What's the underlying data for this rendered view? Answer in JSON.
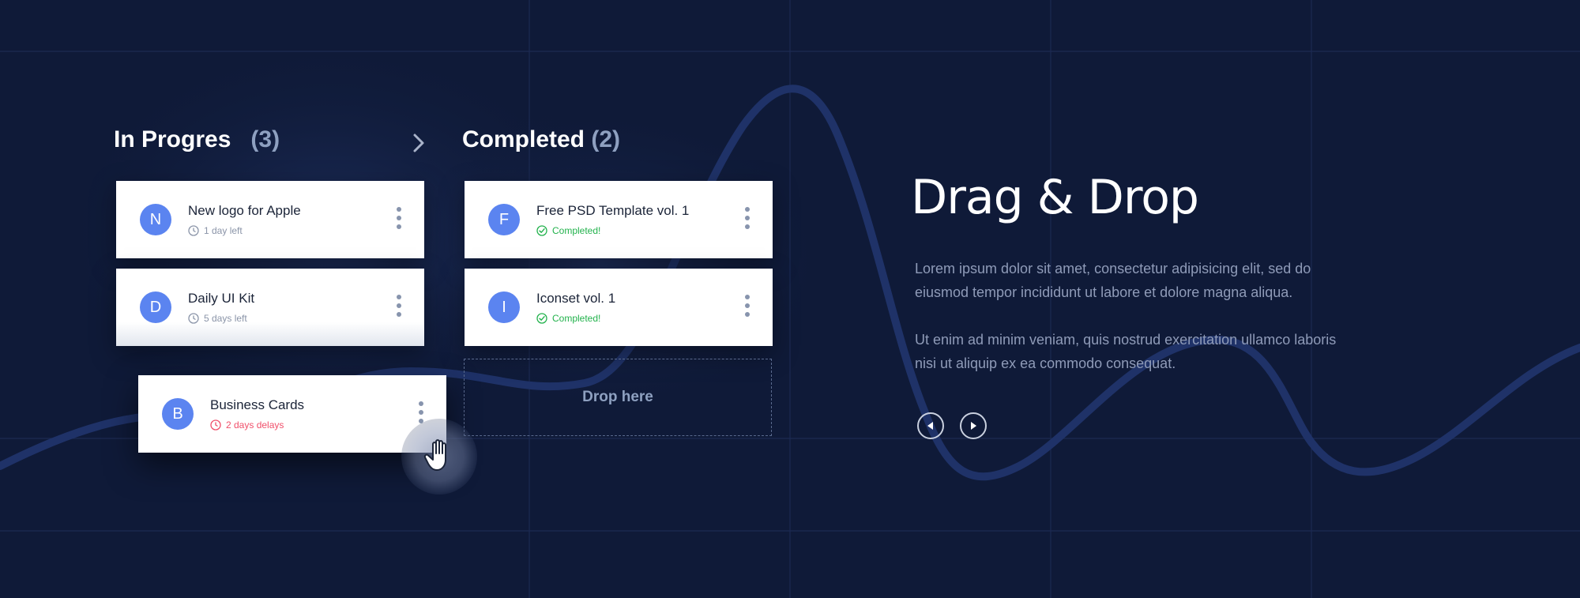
{
  "columns": {
    "in_progress": {
      "title": "In Progres",
      "count": "(3)"
    },
    "completed": {
      "title": "Completed",
      "count": "(2)"
    }
  },
  "in_progress_cards": [
    {
      "initial": "N",
      "title": "New logo for Apple",
      "meta": "1 day left",
      "status": "gray"
    },
    {
      "initial": "D",
      "title": "Daily UI Kit",
      "meta": "5 days left",
      "status": "gray"
    }
  ],
  "dragging_card": {
    "initial": "B",
    "title": "Business Cards",
    "meta": "2 days delays",
    "status": "red"
  },
  "completed_cards": [
    {
      "initial": "F",
      "title": "Free PSD Template vol. 1",
      "meta": "Completed!",
      "status": "green"
    },
    {
      "initial": "I",
      "title": "Iconset vol. 1",
      "meta": "Completed!",
      "status": "green"
    }
  ],
  "dropzone": {
    "label": "Drop here"
  },
  "hero": {
    "title": "Drag & Drop",
    "paragraph1": "Lorem ipsum dolor sit amet, consectetur adipisicing elit, sed do eiusmod tempor incididunt ut labore et dolore magna aliqua.",
    "paragraph2": "Ut enim ad minim veniam, quis nostrud exercitation ullamco laboris nisi ut aliquip ex ea commodo consequat."
  },
  "icons": {
    "next_column": "chevron-right-icon",
    "kebab": "more-vertical-icon",
    "clock": "clock-icon",
    "check": "check-circle-icon",
    "prev": "play-left-icon",
    "next": "play-right-icon",
    "cursor": "grab-hand-icon"
  },
  "colors": {
    "background": "#0f1a38",
    "avatar": "#5b84f0",
    "completed_green": "#22b24c",
    "delay_red": "#f04f6a",
    "muted_text": "#8f9bb8"
  }
}
